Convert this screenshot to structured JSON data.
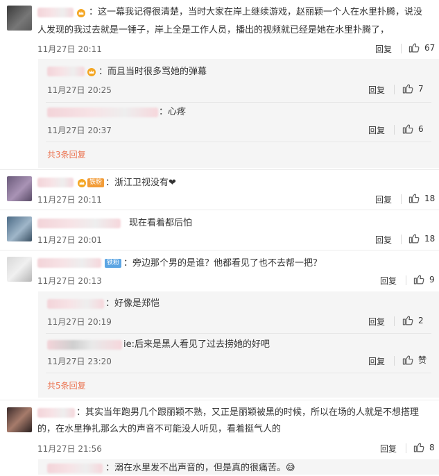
{
  "comments": [
    {
      "text_lines": [
        "：这一幕我记得很清楚，当时大家在岸上继续游戏，赵丽颖一个人在水里扑腾，说没",
        "人发现的我过去就是一锤子，岸上全是工作人员，播出的视频就已经是她在水里扑腾了，"
      ],
      "time": "11月27日 20:11",
      "reply": "回复",
      "likes": "67",
      "replies": [
        {
          "text": "：而且当时很多骂她的弹幕",
          "time": "11月27日 20:25",
          "reply": "回复",
          "likes": "7"
        },
        {
          "text": "：心疼",
          "time": "11月27日 20:37",
          "reply": "回复",
          "likes": "6"
        }
      ],
      "more": "共3条回复"
    },
    {
      "badge": "铁粉",
      "text": "：浙江卫视没有❤",
      "time": "11月27日 20:11",
      "reply": "回复",
      "likes": "18"
    },
    {
      "text": "现在看着都后怕",
      "time": "11月27日 20:01",
      "reply": "回复",
      "likes": "18"
    },
    {
      "badge": "铁粉",
      "text": "：旁边那个男的是谁？他都看见了也不去帮一把？",
      "time": "11月27日 20:13",
      "reply": "回复",
      "likes": "9",
      "replies": [
        {
          "text": "：好像是郑恺",
          "time": "11月27日 20:19",
          "reply": "回复",
          "likes": "2"
        },
        {
          "text": "ie:后来是黑人看见了过去捞她的好吧",
          "time": "11月27日 23:20",
          "reply": "回复",
          "likes": "赞"
        }
      ],
      "more": "共5条回复"
    },
    {
      "text_lines": [
        "：其实当年跑男几个跟丽颖不熟，又正是丽颖被黑的时候，所以在场的人就是不想搭理",
        "的，在水里挣扎那么大的声音不可能没人听见，看着挺气人的"
      ],
      "time": "11月27日 21:56",
      "reply": "回复",
      "likes": "8",
      "replies": [
        {
          "text": "：溺在水里发不出声音的，但是真的很痛苦。😅"
        }
      ]
    }
  ],
  "colors": {
    "accent_orange": "#eb7350",
    "badge_blue": "#5ca5e3",
    "badge_orange": "#f29c38",
    "reply_bg": "#f5f5f5"
  },
  "icons": {
    "like": "thumb-up-icon",
    "crown": "crown-icon"
  }
}
